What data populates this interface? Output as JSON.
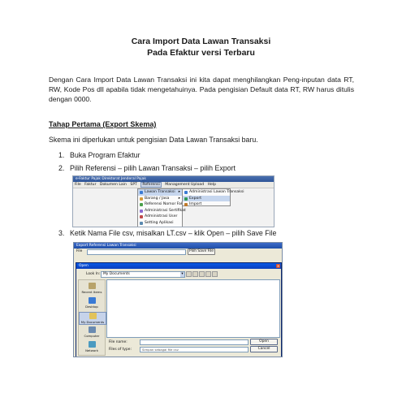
{
  "document": {
    "title_line1": "Cara Import Data Lawan Transaksi",
    "title_line2": "Pada Efaktur versi Terbaru",
    "intro_paragraph": "Dengan Cara Import Data Lawan Transaksi ini kita dapat menghilangkan Peng-inputan data RT, RW, Kode Pos dll apabila tidak mengetahuinya. Pada pengisian Default data RT, RW harus ditulis dengan 0000.",
    "section_title": "Tahap Pertama (Export Skema)",
    "section_intro": "Skema ini diperlukan untuk pengisian Data Lawan Transaksi baru.",
    "steps": [
      {
        "num": "1.",
        "text": "Buka Program Efaktur"
      },
      {
        "num": "2.",
        "text": "Pilih Referensi – pilih Lawan Transaksi – pilih Export"
      },
      {
        "num": "3.",
        "text": "Ketik Nama File csv, misalkan LT.csv – klik Open – pilih Save File"
      }
    ]
  },
  "screenshot1": {
    "window_title": "e-Faktur Pajak Direktorat Jenderal Pajak",
    "menubar": [
      "File",
      "Faktur",
      "Dokumen Lain",
      "SPT",
      "Referensi",
      "Management Upload",
      "Help"
    ],
    "active_menu_index": 4,
    "dropdown_items": [
      {
        "label": "Lawan Transaksi",
        "icon_color": "#3a7bd5",
        "has_arrow": true,
        "highlight": true
      },
      {
        "label": "Barang / Jasa",
        "icon_color": "#d59a3a",
        "has_arrow": true,
        "highlight": false
      },
      {
        "label": "Referensi Nomor Faktur",
        "icon_color": "#4aa04a",
        "has_arrow": false,
        "highlight": false
      },
      {
        "label": "Administrasi Sertifikat",
        "icon_color": "#8a6ad0",
        "has_arrow": false,
        "highlight": false
      },
      {
        "label": "Administrasi User",
        "icon_color": "#c04a4a",
        "has_arrow": false,
        "highlight": false
      },
      {
        "label": "Setting Aplikasi",
        "icon_color": "#5a8ab0",
        "has_arrow": false,
        "highlight": false
      }
    ],
    "submenu_items": [
      {
        "label": "Administrasi Lawan Transaksi",
        "icon_color": "#3a7bd5",
        "highlight": false
      },
      {
        "label": "Export",
        "icon_color": "#2f9a5a",
        "highlight": true
      },
      {
        "label": "Import",
        "icon_color": "#c07a2a",
        "highlight": false
      }
    ]
  },
  "screenshot2": {
    "outer_title": "Export Referensi Lawan Transaksi",
    "outer_file_label": "File",
    "outer_button": "Pilih Save File",
    "open_title": "Open",
    "look_in_label": "Look In:",
    "look_in_value": "My Documents",
    "places": [
      {
        "label": "Recent Items",
        "color": "#b8a36a",
        "selected": false
      },
      {
        "label": "Desktop",
        "color": "#3a7bd5",
        "selected": false
      },
      {
        "label": "My Documents",
        "color": "#e2c35a",
        "selected": true
      },
      {
        "label": "Computer",
        "color": "#6a8ab0",
        "selected": false
      },
      {
        "label": "Network",
        "color": "#4a9ac0",
        "selected": false
      }
    ],
    "file_name_label": "File name:",
    "files_of_type_label": "Files of type:",
    "files_of_type_value": "Simpan sebagai file csv",
    "open_button": "Open",
    "cancel_button": "Cancel"
  }
}
